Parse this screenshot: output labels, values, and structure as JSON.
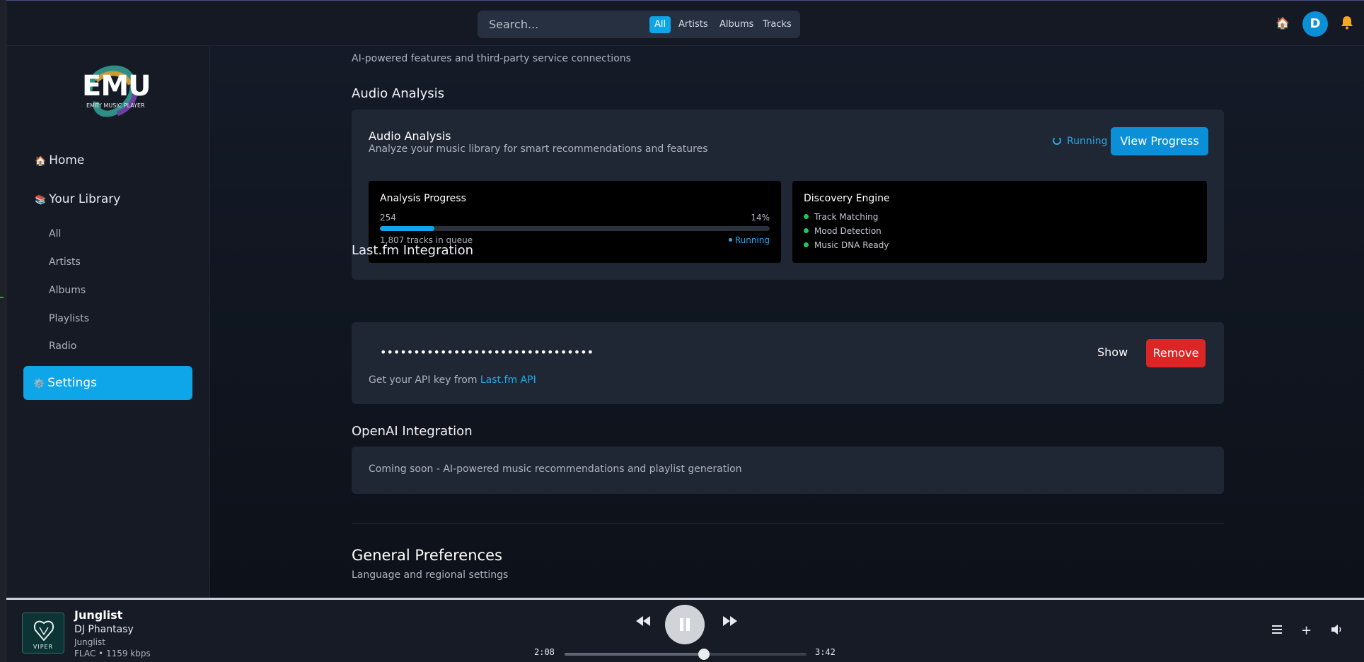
{
  "topbar": {
    "search_placeholder": "Search...",
    "filters": [
      "All",
      "Artists",
      "Albums",
      "Tracks"
    ],
    "active_filter": "All",
    "home_emoji": "🏠",
    "avatar_initial": "D",
    "bell_icon": "bell-icon"
  },
  "sidebar": {
    "logo_text": "EMU",
    "logo_subtitle": "EMBY MUSIC PLAYER",
    "home_icon": "🏠",
    "home_label": "Home",
    "library_icon": "📚",
    "library_label": "Your Library",
    "library_items": [
      "All",
      "Artists",
      "Albums",
      "Playlists",
      "Radio"
    ],
    "settings_icon": "⚙️",
    "settings_label": "Settings"
  },
  "main": {
    "section_subtitle": "AI-powered features and third-party service connections",
    "audio_analysis": {
      "heading": "Audio Analysis",
      "card_title": "Audio Analysis",
      "card_desc": "Analyze your music library for smart recommendations and features",
      "status": "Running",
      "view_button": "View Progress",
      "progress": {
        "title": "Analysis Progress",
        "count": "254",
        "percent_label": "14%",
        "percent": 14,
        "queue": "1,807 tracks in queue",
        "status": "Running"
      },
      "discovery": {
        "title": "Discovery Engine",
        "features": [
          "Track Matching",
          "Mood Detection",
          "Music DNA Ready"
        ]
      }
    },
    "lastfm": {
      "heading": "Last.fm Integration",
      "api_key_masked": "••••••••••••••••••••••••••••••••",
      "show_button": "Show",
      "remove_button": "Remove",
      "help_text": "Get your API key from ",
      "help_link": "Last.fm API"
    },
    "openai": {
      "heading": "OpenAI Integration",
      "text": "Coming soon - AI-powered music recommendations and playlist generation"
    },
    "general": {
      "title": "General Preferences",
      "subtitle": "Language and regional settings"
    }
  },
  "player": {
    "cover_label": "VIPER",
    "title": "Junglist",
    "artist": "DJ Phantasy",
    "album": "Junglist",
    "format": "FLAC • 1159 kbps",
    "current_time": "2:08",
    "total_time": "3:42",
    "progress_fraction": 0.577
  }
}
